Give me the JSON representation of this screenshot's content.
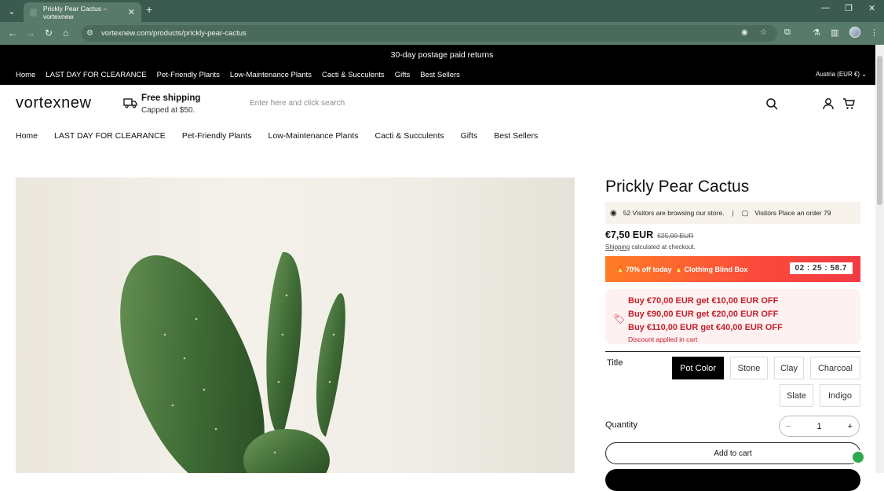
{
  "browser": {
    "tab_title": "Prickly Pear Cactus – vortexnew",
    "url": "vortexnew.com/products/prickly-pear-cactus"
  },
  "announcement": "30-day postage paid returns",
  "topnav": {
    "items": [
      "Home",
      "LAST DAY FOR CLEARANCE",
      "Pet-Friendly Plants",
      "Low-Maintenance Plants",
      "Cacti & Succulents",
      "Gifts",
      "Best Sellers"
    ],
    "locale": "Austria  (EUR €)"
  },
  "header": {
    "logo": "vortexnew",
    "shipping_title": "Free shipping",
    "shipping_sub": "Capped at $50.",
    "search_placeholder": "Enter here and click search"
  },
  "mainnav": {
    "items": [
      "Home",
      "LAST DAY FOR CLEARANCE",
      "Pet-Friendly Plants",
      "Low-Maintenance Plants",
      "Cacti & Succulents",
      "Gifts",
      "Best Sellers"
    ]
  },
  "product": {
    "title": "Prickly Pear Cactus",
    "visitors_browsing": "52 Visitors are browsing our store.",
    "visitors_order": "Visitors Place an order 79",
    "price": "€7,50 EUR",
    "compare_price": "€25,00 EUR",
    "shipping_link": "Shipping",
    "shipping_note": " calculated at checkout.",
    "promo_text": "70% off today",
    "promo_text2": "Clothing Blind Box",
    "timer": "02 : 25 : 58.7",
    "discounts": [
      "Buy €70,00 EUR get €10,00 EUR OFF",
      "Buy €90,00 EUR get €20,00 EUR OFF",
      "Buy €110,00 EUR get €40,00 EUR OFF"
    ],
    "discount_applied": "Discount applied in cart",
    "option_label": "Title",
    "options": [
      "Pot Color",
      "Stone",
      "Clay",
      "Charcoal",
      "Slate",
      "Indigo"
    ],
    "selected_option": "Pot Color",
    "quantity_label": "Quantity",
    "quantity": "1",
    "add_to_cart": "Add to cart"
  },
  "colors": {
    "chrome": "#587a6b",
    "promo_start": "#ff7d26",
    "promo_end": "#f33a44",
    "discount_text": "#c3202c"
  }
}
